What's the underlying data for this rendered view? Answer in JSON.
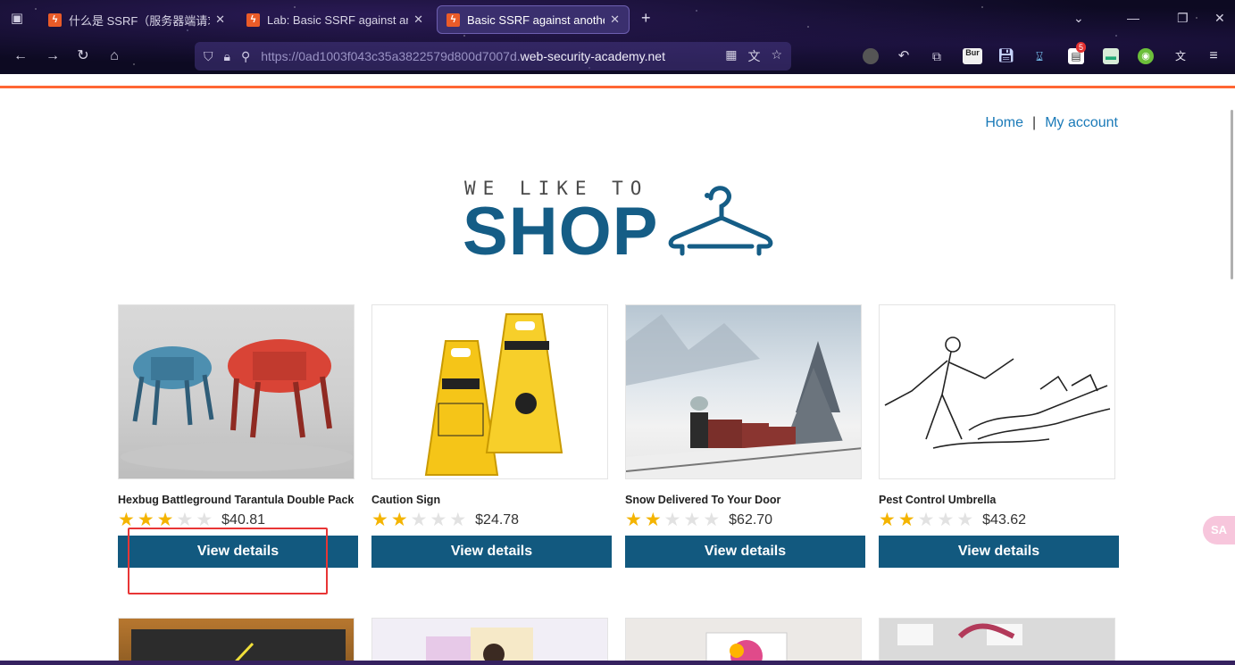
{
  "browser": {
    "tabs": [
      {
        "title": "什么是 SSRF（服务器端请求伪造",
        "active": false
      },
      {
        "title": "Lab: Basic SSRF against anoth",
        "active": false
      },
      {
        "title": "Basic SSRF against another b",
        "active": true
      }
    ],
    "url": {
      "scheme": "https://",
      "subdomain": "0ad1003f043c35a3822579d800d7007d.",
      "domain": "web-security-academy.net"
    },
    "extensions": {
      "burp_label": "Bur",
      "badge_count": "5"
    },
    "side_bubble": "SA"
  },
  "site": {
    "nav": {
      "home": "Home",
      "separator": "|",
      "account": "My account"
    },
    "logo": {
      "tagline": "WE LIKE TO",
      "word": "SHOP"
    },
    "accent_color": "#ff6633",
    "brand_color": "#155d86",
    "button_color": "#12597f"
  },
  "products": [
    {
      "name": "Hexbug Battleground Tarantula Double Pack",
      "rating": 3,
      "price": "$40.81",
      "button": "View details"
    },
    {
      "name": "Caution Sign",
      "rating": 2,
      "price": "$24.78",
      "button": "View details"
    },
    {
      "name": "Snow Delivered To Your Door",
      "rating": 2,
      "price": "$62.70",
      "button": "View details"
    },
    {
      "name": "Pest Control Umbrella",
      "rating": 2,
      "price": "$43.62",
      "button": "View details"
    }
  ]
}
